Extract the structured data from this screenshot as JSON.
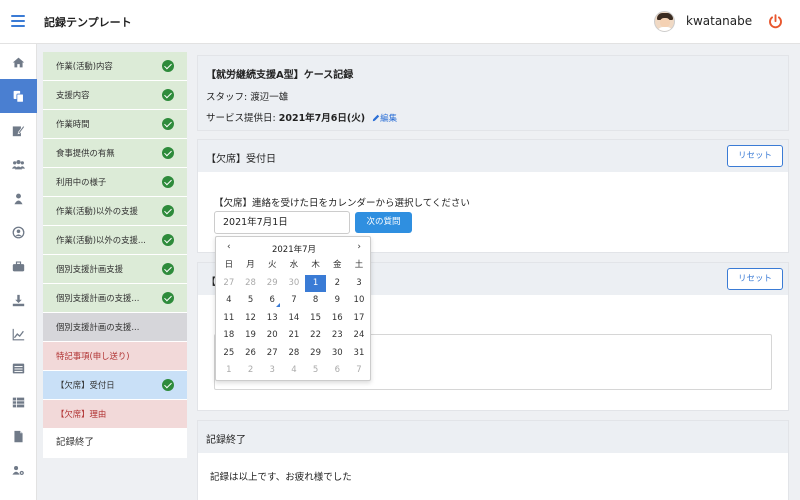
{
  "app": {
    "title": "記録テンプレート",
    "username": "kwatanabe"
  },
  "colors": {
    "accent": "#3a7bd5",
    "step_done": "#dcebd7",
    "step_current": "#c9e0f7",
    "step_pending": "#f2d9d9",
    "check": "#2e8b3b"
  },
  "iconbar": {
    "items": [
      "home-icon",
      "copy-icon",
      "edit-icon",
      "users-icon",
      "user-icon",
      "account-circle-icon",
      "briefcase-icon",
      "download-icon",
      "chart-line-icon",
      "list-icon",
      "table-icon",
      "file-icon",
      "settings-users-icon"
    ]
  },
  "steps": [
    {
      "label": "作業(活動)内容",
      "state": "done"
    },
    {
      "label": "支援内容",
      "state": "done"
    },
    {
      "label": "作業時間",
      "state": "done"
    },
    {
      "label": "食事提供の有無",
      "state": "done"
    },
    {
      "label": "利用中の様子",
      "state": "done"
    },
    {
      "label": "作業(活動)以外の支援",
      "state": "done"
    },
    {
      "label": "作業(活動)以外の支援...",
      "state": "done"
    },
    {
      "label": "個別支援計画支援",
      "state": "done"
    },
    {
      "label": "個別支援計画の支援...",
      "state": "done"
    },
    {
      "label": "個別支援計画の支援...",
      "state": "skipped"
    },
    {
      "label": "特記事項(申し送り)",
      "state": "pending"
    },
    {
      "label": "【欠席】受付日",
      "state": "current"
    },
    {
      "label": "【欠席】理由",
      "state": "pending"
    },
    {
      "label": "記録終了",
      "state": "end"
    }
  ],
  "record": {
    "title": "【就労継続支援A型】ケース記録",
    "staff": "スタッフ: 渡辺一雄",
    "service_date_label": "サービス提供日: ",
    "service_date": "2021年7月6日(火)",
    "edit_label": "編集"
  },
  "absence_date": {
    "title": "【欠席】受付日",
    "reset_label": "リセット",
    "question": "【欠席】連絡を受けた日をカレンダーから選択してください",
    "value": "2021年7月1日",
    "next_label": "次の質問"
  },
  "absence_reason": {
    "title": "【",
    "reset_label": "リセット"
  },
  "end_card": {
    "title": "記録終了",
    "text": "記録は以上です、お疲れ様でした"
  },
  "calendar": {
    "prev": "‹",
    "next": "›",
    "month": "2021年7月",
    "weekdays": [
      "日",
      "月",
      "火",
      "水",
      "木",
      "金",
      "土"
    ],
    "weeks": [
      [
        {
          "d": "27",
          "m": true
        },
        {
          "d": "28",
          "m": true
        },
        {
          "d": "29",
          "m": true
        },
        {
          "d": "30",
          "m": true
        },
        {
          "d": "1",
          "sel": true
        },
        {
          "d": "2"
        },
        {
          "d": "3"
        }
      ],
      [
        {
          "d": "4"
        },
        {
          "d": "5"
        },
        {
          "d": "6",
          "today": true
        },
        {
          "d": "7"
        },
        {
          "d": "8"
        },
        {
          "d": "9"
        },
        {
          "d": "10"
        }
      ],
      [
        {
          "d": "11"
        },
        {
          "d": "12"
        },
        {
          "d": "13"
        },
        {
          "d": "14"
        },
        {
          "d": "15"
        },
        {
          "d": "16"
        },
        {
          "d": "17"
        }
      ],
      [
        {
          "d": "18"
        },
        {
          "d": "19"
        },
        {
          "d": "20"
        },
        {
          "d": "21"
        },
        {
          "d": "22"
        },
        {
          "d": "23"
        },
        {
          "d": "24"
        }
      ],
      [
        {
          "d": "25"
        },
        {
          "d": "26"
        },
        {
          "d": "27"
        },
        {
          "d": "28"
        },
        {
          "d": "29"
        },
        {
          "d": "30"
        },
        {
          "d": "31"
        }
      ],
      [
        {
          "d": "1",
          "m": true
        },
        {
          "d": "2",
          "m": true
        },
        {
          "d": "3",
          "m": true
        },
        {
          "d": "4",
          "m": true
        },
        {
          "d": "5",
          "m": true
        },
        {
          "d": "6",
          "m": true
        },
        {
          "d": "7",
          "m": true
        }
      ]
    ]
  }
}
